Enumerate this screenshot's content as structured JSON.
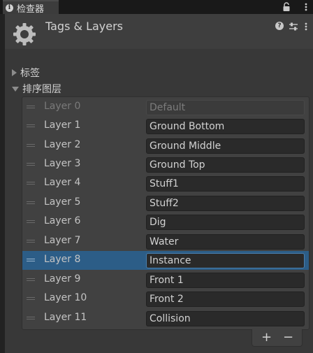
{
  "tab": {
    "title": "检查器",
    "info_icon": "info-icon",
    "lock_icon": "lock-icon",
    "menu_icon": "kebab-menu-icon"
  },
  "header": {
    "title": "Tags & Layers",
    "help_icon": "help-icon",
    "presets_icon": "presets-icon",
    "menu_icon": "kebab-menu-icon",
    "component_icon": "gear-icon"
  },
  "foldouts": {
    "tags": "标签",
    "sorting_layers": "排序图层"
  },
  "layers": [
    {
      "label": "Layer 0",
      "name": "Default",
      "disabled": true
    },
    {
      "label": "Layer 1",
      "name": "Ground Bottom"
    },
    {
      "label": "Layer 2",
      "name": "Ground Middle"
    },
    {
      "label": "Layer 3",
      "name": "Ground Top"
    },
    {
      "label": "Layer 4",
      "name": "Stuff1"
    },
    {
      "label": "Layer 5",
      "name": "Stuff2"
    },
    {
      "label": "Layer 6",
      "name": "Dig"
    },
    {
      "label": "Layer 7",
      "name": "Water"
    },
    {
      "label": "Layer 8",
      "name": "Instance",
      "selected": true
    },
    {
      "label": "Layer 9",
      "name": "Front 1"
    },
    {
      "label": "Layer 10",
      "name": "Front 2"
    },
    {
      "label": "Layer 11",
      "name": "Collision"
    }
  ],
  "footer": {
    "add_label": "+",
    "remove_label": "−"
  },
  "colors": {
    "background": "#383838",
    "selection": "#2c5d87",
    "field": "#2a2a2a"
  }
}
